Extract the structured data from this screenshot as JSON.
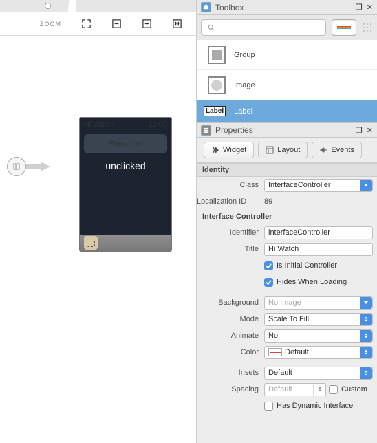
{
  "toolbar": {
    "zoom_label": "ZOOM"
  },
  "watch": {
    "title": "Hi Watch",
    "time": "12:00",
    "button": "Press me!",
    "label": "unclicked"
  },
  "toolbox": {
    "title": "Toolbox",
    "search_placeholder": "",
    "items": [
      {
        "label": "Group"
      },
      {
        "label": "Image"
      },
      {
        "icon_text": "Label",
        "label": "Label"
      }
    ]
  },
  "properties": {
    "title": "Properties",
    "tabs": {
      "widget": "Widget",
      "layout": "Layout",
      "events": "Events"
    },
    "identity": {
      "header": "Identity",
      "class_label": "Class",
      "class_value": "InterfaceController",
      "locid_label": "Localization ID",
      "locid_value": "89"
    },
    "controller": {
      "header": "Interface Controller",
      "identifier_label": "Identifier",
      "identifier_value": "interfaceController",
      "title_label": "Title",
      "title_value": "Hi Watch",
      "initial": "Is Initial Controller",
      "hides": "Hides When Loading",
      "bg_label": "Background",
      "bg_value": "No Image",
      "mode_label": "Mode",
      "mode_value": "Scale To Fill",
      "animate_label": "Animate",
      "animate_value": "No",
      "color_label": "Color",
      "color_value": "Default",
      "insets_label": "Insets",
      "insets_value": "Default",
      "spacing_label": "Spacing",
      "spacing_value": "Default",
      "custom": "Custom",
      "dynamic": "Has Dynamic Interface"
    }
  }
}
